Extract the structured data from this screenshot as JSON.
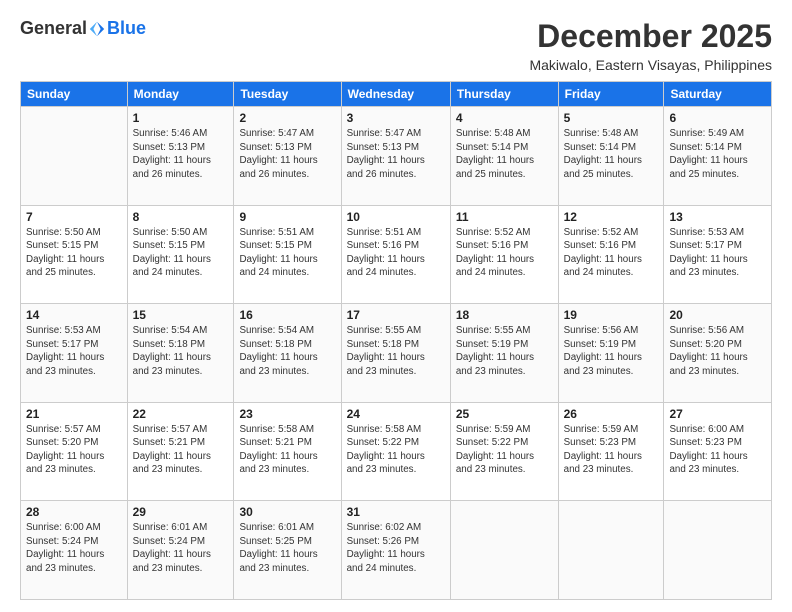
{
  "logo": {
    "general": "General",
    "blue": "Blue"
  },
  "header": {
    "month": "December 2025",
    "location": "Makiwalo, Eastern Visayas, Philippines"
  },
  "weekdays": [
    "Sunday",
    "Monday",
    "Tuesday",
    "Wednesday",
    "Thursday",
    "Friday",
    "Saturday"
  ],
  "weeks": [
    [
      {
        "day": "",
        "info": ""
      },
      {
        "day": "1",
        "info": "Sunrise: 5:46 AM\nSunset: 5:13 PM\nDaylight: 11 hours\nand 26 minutes."
      },
      {
        "day": "2",
        "info": "Sunrise: 5:47 AM\nSunset: 5:13 PM\nDaylight: 11 hours\nand 26 minutes."
      },
      {
        "day": "3",
        "info": "Sunrise: 5:47 AM\nSunset: 5:13 PM\nDaylight: 11 hours\nand 26 minutes."
      },
      {
        "day": "4",
        "info": "Sunrise: 5:48 AM\nSunset: 5:14 PM\nDaylight: 11 hours\nand 25 minutes."
      },
      {
        "day": "5",
        "info": "Sunrise: 5:48 AM\nSunset: 5:14 PM\nDaylight: 11 hours\nand 25 minutes."
      },
      {
        "day": "6",
        "info": "Sunrise: 5:49 AM\nSunset: 5:14 PM\nDaylight: 11 hours\nand 25 minutes."
      }
    ],
    [
      {
        "day": "7",
        "info": "Sunrise: 5:50 AM\nSunset: 5:15 PM\nDaylight: 11 hours\nand 25 minutes."
      },
      {
        "day": "8",
        "info": "Sunrise: 5:50 AM\nSunset: 5:15 PM\nDaylight: 11 hours\nand 24 minutes."
      },
      {
        "day": "9",
        "info": "Sunrise: 5:51 AM\nSunset: 5:15 PM\nDaylight: 11 hours\nand 24 minutes."
      },
      {
        "day": "10",
        "info": "Sunrise: 5:51 AM\nSunset: 5:16 PM\nDaylight: 11 hours\nand 24 minutes."
      },
      {
        "day": "11",
        "info": "Sunrise: 5:52 AM\nSunset: 5:16 PM\nDaylight: 11 hours\nand 24 minutes."
      },
      {
        "day": "12",
        "info": "Sunrise: 5:52 AM\nSunset: 5:16 PM\nDaylight: 11 hours\nand 24 minutes."
      },
      {
        "day": "13",
        "info": "Sunrise: 5:53 AM\nSunset: 5:17 PM\nDaylight: 11 hours\nand 23 minutes."
      }
    ],
    [
      {
        "day": "14",
        "info": "Sunrise: 5:53 AM\nSunset: 5:17 PM\nDaylight: 11 hours\nand 23 minutes."
      },
      {
        "day": "15",
        "info": "Sunrise: 5:54 AM\nSunset: 5:18 PM\nDaylight: 11 hours\nand 23 minutes."
      },
      {
        "day": "16",
        "info": "Sunrise: 5:54 AM\nSunset: 5:18 PM\nDaylight: 11 hours\nand 23 minutes."
      },
      {
        "day": "17",
        "info": "Sunrise: 5:55 AM\nSunset: 5:18 PM\nDaylight: 11 hours\nand 23 minutes."
      },
      {
        "day": "18",
        "info": "Sunrise: 5:55 AM\nSunset: 5:19 PM\nDaylight: 11 hours\nand 23 minutes."
      },
      {
        "day": "19",
        "info": "Sunrise: 5:56 AM\nSunset: 5:19 PM\nDaylight: 11 hours\nand 23 minutes."
      },
      {
        "day": "20",
        "info": "Sunrise: 5:56 AM\nSunset: 5:20 PM\nDaylight: 11 hours\nand 23 minutes."
      }
    ],
    [
      {
        "day": "21",
        "info": "Sunrise: 5:57 AM\nSunset: 5:20 PM\nDaylight: 11 hours\nand 23 minutes."
      },
      {
        "day": "22",
        "info": "Sunrise: 5:57 AM\nSunset: 5:21 PM\nDaylight: 11 hours\nand 23 minutes."
      },
      {
        "day": "23",
        "info": "Sunrise: 5:58 AM\nSunset: 5:21 PM\nDaylight: 11 hours\nand 23 minutes."
      },
      {
        "day": "24",
        "info": "Sunrise: 5:58 AM\nSunset: 5:22 PM\nDaylight: 11 hours\nand 23 minutes."
      },
      {
        "day": "25",
        "info": "Sunrise: 5:59 AM\nSunset: 5:22 PM\nDaylight: 11 hours\nand 23 minutes."
      },
      {
        "day": "26",
        "info": "Sunrise: 5:59 AM\nSunset: 5:23 PM\nDaylight: 11 hours\nand 23 minutes."
      },
      {
        "day": "27",
        "info": "Sunrise: 6:00 AM\nSunset: 5:23 PM\nDaylight: 11 hours\nand 23 minutes."
      }
    ],
    [
      {
        "day": "28",
        "info": "Sunrise: 6:00 AM\nSunset: 5:24 PM\nDaylight: 11 hours\nand 23 minutes."
      },
      {
        "day": "29",
        "info": "Sunrise: 6:01 AM\nSunset: 5:24 PM\nDaylight: 11 hours\nand 23 minutes."
      },
      {
        "day": "30",
        "info": "Sunrise: 6:01 AM\nSunset: 5:25 PM\nDaylight: 11 hours\nand 23 minutes."
      },
      {
        "day": "31",
        "info": "Sunrise: 6:02 AM\nSunset: 5:26 PM\nDaylight: 11 hours\nand 24 minutes."
      },
      {
        "day": "",
        "info": ""
      },
      {
        "day": "",
        "info": ""
      },
      {
        "day": "",
        "info": ""
      }
    ]
  ]
}
